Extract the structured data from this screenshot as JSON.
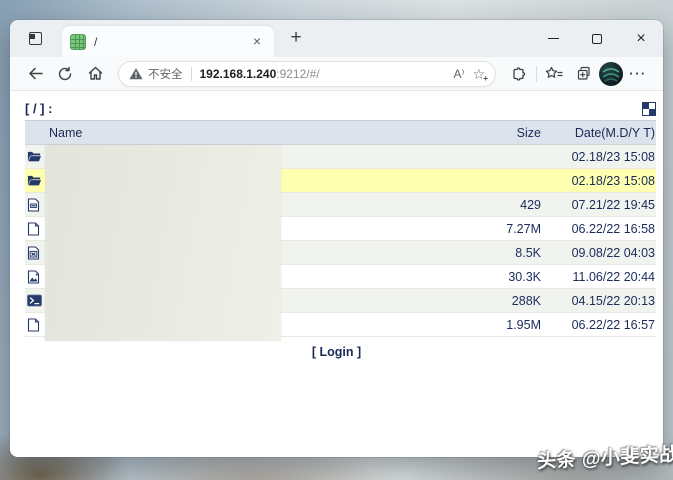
{
  "browser": {
    "tab": {
      "title": "/",
      "close_label": "×"
    },
    "new_tab_label": "+",
    "address": {
      "warning_text": "不安全",
      "host": "192.168.1.240",
      "suffix": ":9212/#/",
      "read_aloud_label": "A⁾"
    },
    "more_label": "···"
  },
  "page": {
    "breadcrumb": "[ / ] :",
    "table": {
      "headers": {
        "name": "Name",
        "size": "Size",
        "date": "Date(M.D/Y T)"
      },
      "rows": [
        {
          "icon": "folder-open-icon",
          "size": "",
          "date": "02.18/23 15:08"
        },
        {
          "icon": "folder-open-icon",
          "size": "",
          "date": "02.18/23 15:08"
        },
        {
          "icon": "text-file-icon",
          "size": "429",
          "date": "07.21/22 19:45"
        },
        {
          "icon": "file-icon",
          "size": "7.27M",
          "date": "06.22/22 16:58"
        },
        {
          "icon": "executable-file-icon",
          "size": "8.5K",
          "date": "09.08/22 04:03"
        },
        {
          "icon": "image-file-icon",
          "size": "30.3K",
          "date": "11.06/22 20:44"
        },
        {
          "icon": "terminal-file-icon",
          "size": "288K",
          "date": "04.15/22 20:13"
        },
        {
          "icon": "file-icon",
          "size": "1.95M",
          "date": "06.22/22 16:57"
        }
      ]
    },
    "login_label": "[ Login ]"
  },
  "watermark": "头条 @小斐实战",
  "colors": {
    "navy": "#1a2a55",
    "highlight_row": "#ffffb0",
    "alt_row": "#f1f3ef",
    "header_row": "#dce3ed",
    "redaction_block": "#e7e9e1",
    "favicon_green": "#7cc57f"
  }
}
